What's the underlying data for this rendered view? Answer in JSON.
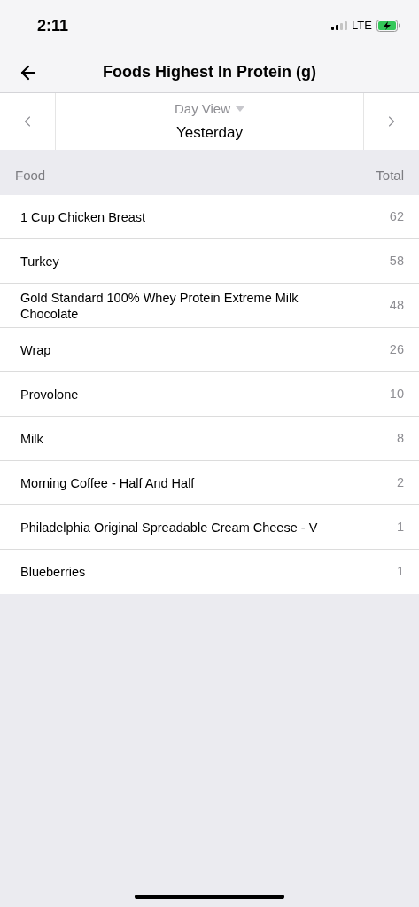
{
  "status_bar": {
    "time": "2:11",
    "network": "LTE"
  },
  "nav": {
    "title": "Foods Highest In Protein (g)"
  },
  "date_selector": {
    "view": "Day View",
    "date": "Yesterday"
  },
  "table": {
    "columns": [
      "Food",
      "Total"
    ],
    "rows": [
      {
        "food": "1 Cup Chicken Breast",
        "total": "62"
      },
      {
        "food": "Turkey",
        "total": "58"
      },
      {
        "food": "Gold Standard 100% Whey Protein Extreme Milk Chocolate",
        "total": "48"
      },
      {
        "food": "Wrap",
        "total": "26"
      },
      {
        "food": "Provolone",
        "total": "10"
      },
      {
        "food": "Milk",
        "total": "8"
      },
      {
        "food": "Morning Coffee - Half And Half",
        "total": "2"
      },
      {
        "food": "Philadelphia Original Spreadable Cream Cheese - V",
        "total": "1"
      },
      {
        "food": "Blueberries",
        "total": "1"
      }
    ]
  }
}
